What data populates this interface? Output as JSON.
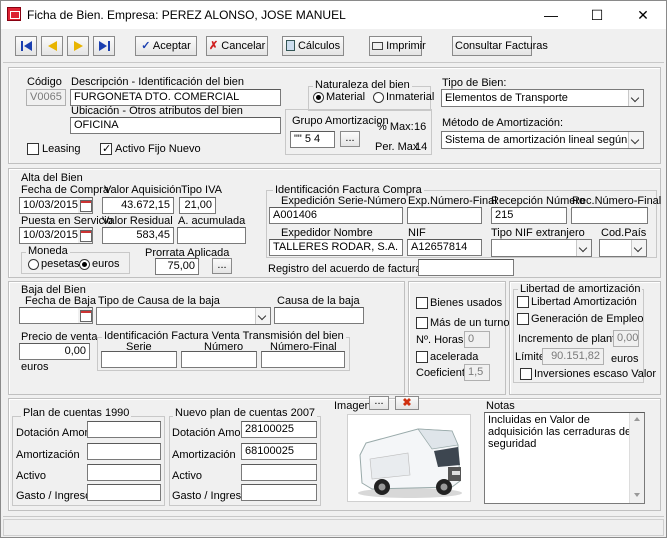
{
  "window": {
    "title": "Ficha de  Bien. Empresa:  PEREZ ALONSO, JOSE MANUEL",
    "min": "—",
    "max": "☐",
    "close": "✕"
  },
  "toolbar": {
    "accept": "Aceptar",
    "cancel": "Cancelar",
    "calc": "Cálculos",
    "print": "Imprimir",
    "invoices": "Consultar Facturas"
  },
  "header": {
    "codigo_label": "Código",
    "codigo": "V0065",
    "desc_label": "Descripción - Identificación del bien",
    "desc": "FURGONETA DTO. COMERCIAL",
    "ubic_label": "Ubicación - Otros atributos del bien",
    "ubic": "OFICINA",
    "naturaleza_label": "Naturaleza del bien",
    "material": "Material",
    "inmaterial": "Inmaterial",
    "grupo_label": "Grupo Amortizacion",
    "grupo": "\"\" 5 4",
    "grupo_btn": "...",
    "pmax_label": "% Max:",
    "pmax": "16",
    "permax_label": "Per. Max",
    "permax": "14",
    "tipo_label": "Tipo de Bien:",
    "tipo": "Elementos de Transporte",
    "metodo_label": "Método de Amortización:",
    "metodo": "Sistema de amortización lineal según tablas",
    "leasing": "Leasing",
    "activo_fijo": "Activo Fijo Nuevo"
  },
  "alta": {
    "group": "Alta del Bien",
    "fecha_compra_label": "Fecha de Compra",
    "fecha_compra": "10/03/2015",
    "valor_adq_label": "Valor Aquisición",
    "valor_adq": "43.672,15",
    "tipo_iva_label": "Tipo IVA",
    "tipo_iva": "21,00",
    "puesta_label": "Puesta en Servicio",
    "puesta": "10/03/2015",
    "residual_label": "Valor Residual",
    "residual": "583,45",
    "acum_label": "A. acumulada",
    "acum": "",
    "moneda_label": "Moneda",
    "pesetas": "pesetas",
    "euros": "euros",
    "prorrata_label": "Prorrata Aplicada",
    "prorrata": "75,00",
    "prorrata_btn": "...",
    "fact_compra_label": "Identificación Factura Compra",
    "exp_serie_label": "Expedición Serie-Número",
    "exp_serie": "A001406",
    "exp_final_label": "Exp.Número-Final",
    "exp_final": "",
    "recep_label": "Recepción Número",
    "recep": "215",
    "rec_final_label": "Rec.Número-Final",
    "rec_final": "",
    "expedidor_label": "Expedidor Nombre",
    "expedidor": "TALLERES RODAR, S.A.",
    "nif_label": "NIF",
    "nif": "A12657814",
    "tipo_nif_label": "Tipo NIF extranjero",
    "tipo_nif": "",
    "cod_pais_label": "Cod.País",
    "cod_pais": "",
    "registro_label": "Registro del acuerdo de facturación:",
    "registro": ""
  },
  "baja": {
    "group": "Baja del Bien",
    "fecha_label": "Fecha de Baja",
    "fecha": "",
    "tipo_causa_label": "Tipo de Causa de la baja",
    "tipo_causa": "",
    "causa_label": "Causa de la baja",
    "causa": "",
    "precio_label": "Precio de venta",
    "precio": "0,00",
    "euros": "euros",
    "fact_venta_label": "Identificación Factura Venta Transmisión del bien",
    "serie_label": "Serie",
    "numero_label": "Número",
    "numero_final_label": "Número-Final",
    "serie": "",
    "numero": "",
    "numero_final": ""
  },
  "opciones": {
    "bienes_usados": "Bienes usados",
    "mas_turno": "Más de un turno",
    "horas_label": "Nº. Horas",
    "horas": "0",
    "acelerada": "acelerada",
    "coef_label": "Coeficiente",
    "coef": "1,5"
  },
  "libertad": {
    "group": "Libertad de amortización",
    "libertad": "Libertad Amortización",
    "empleo": "Generación de Empleo",
    "incremento_label": "Incremento de plantilla",
    "incremento": "0,00",
    "limite_label": "Límite",
    "limite": "90.151,82",
    "euros": "euros",
    "inversiones": "Inversiones escaso Valor"
  },
  "plan1990": {
    "title": "Plan de cuentas 1990",
    "dotacion_label": "Dotación Amort.",
    "amort_label": "Amortización",
    "activo_label": "Activo",
    "gasto_label": "Gasto / Ingreso",
    "dotacion": "",
    "amort": "",
    "activo": "",
    "gasto": ""
  },
  "plan2007": {
    "title": "Nuevo plan de cuentas 2007",
    "dotacion_label": "Dotación Amort.",
    "amort_label": "Amortización",
    "activo_label": "Activo",
    "gasto_label": "Gasto / Ingreso",
    "dotacion": "28100025",
    "amort": "68100025",
    "activo": "",
    "gasto": ""
  },
  "imagen": {
    "label": "Imagen",
    "btn": "...",
    "del": "✖"
  },
  "notas": {
    "label": "Notas",
    "text": "Incluidas en Valor de adquisición las cerraduras de seguridad"
  }
}
